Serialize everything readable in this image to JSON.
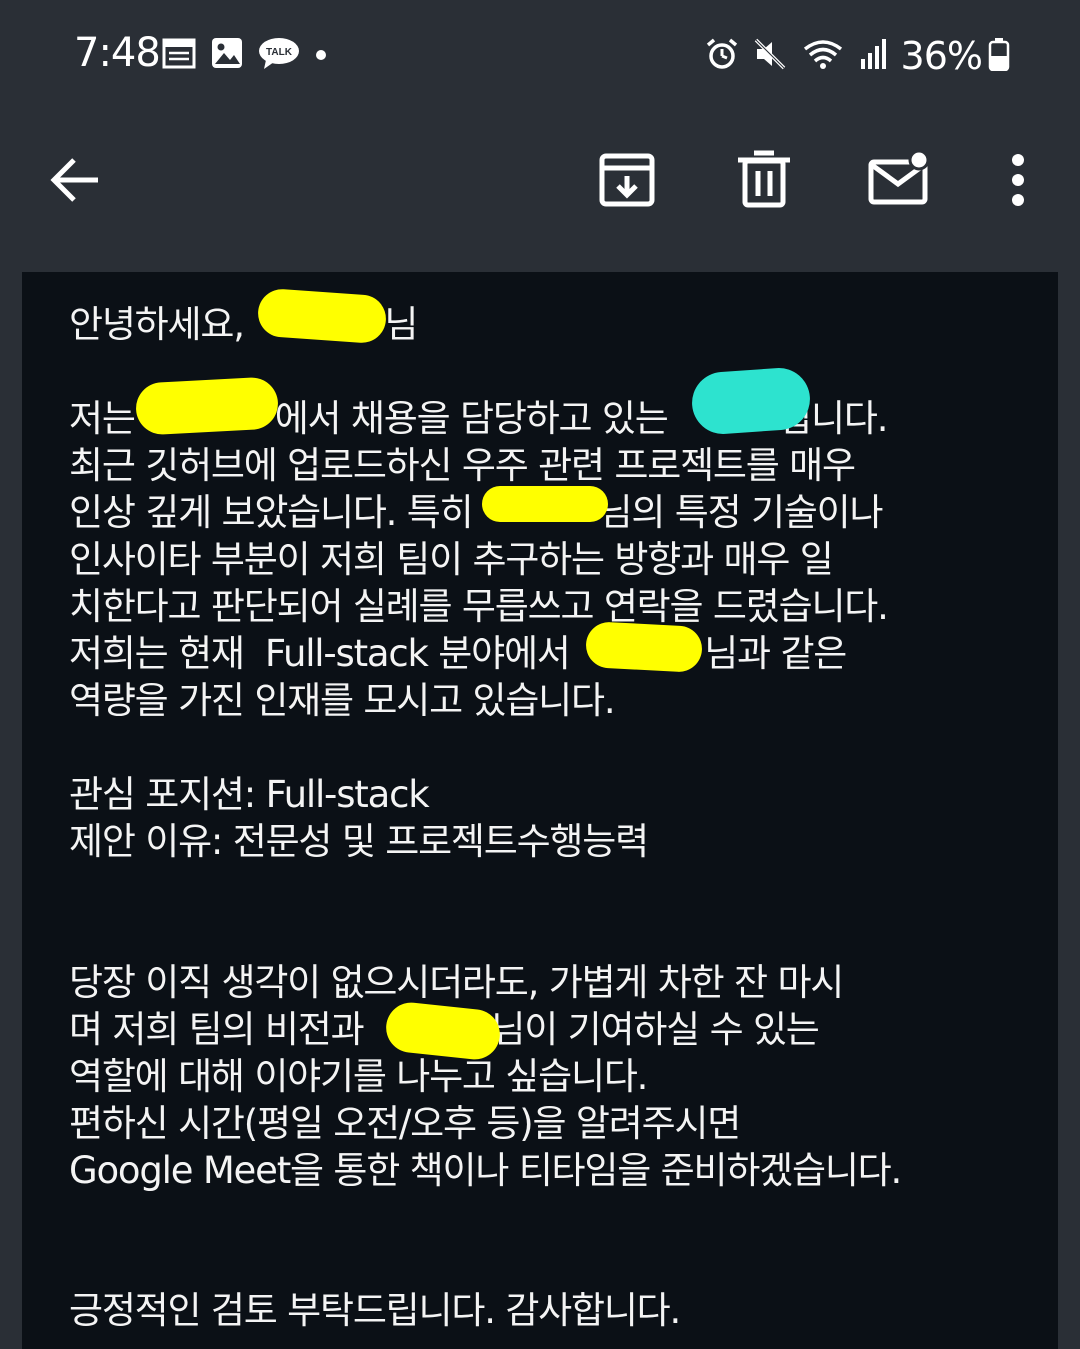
{
  "status_bar": {
    "time": "7:48",
    "left_icons": [
      "calendar-icon",
      "image-icon",
      "talk-icon",
      "notification-dot-icon"
    ],
    "talk_label": "TALK",
    "right_icons": [
      "alarm-icon",
      "mute-icon",
      "wifi-icon",
      "signal-icon",
      "battery-icon"
    ],
    "battery_percent": "36%"
  },
  "toolbar": {
    "icons": [
      "back-arrow-icon",
      "archive-icon",
      "delete-icon",
      "mark-unread-icon",
      "more-icon"
    ]
  },
  "email": {
    "lines": [
      {
        "id": "l1",
        "segs": [
          "안녕하세요, ",
          "님"
        ]
      },
      {
        "id": "l2",
        "segs": [
          "저는",
          "에서 채용을 담당하고 있는 ",
          "입니다."
        ]
      },
      {
        "id": "l3",
        "segs": [
          "최근 깃허브에 업로드하신 우주 관련 프로젝트를 매우"
        ]
      },
      {
        "id": "l4",
        "segs": [
          "인상 깊게 보았습니다. 특히",
          "님의 특정 기술이나"
        ]
      },
      {
        "id": "l5",
        "segs": [
          "인사이타 부분이 저희 팀이 추구하는 방향과 매우 일"
        ]
      },
      {
        "id": "l6",
        "segs": [
          "치한다고 판단되어 실례를 무릅쓰고 연락을 드렸습니다."
        ]
      },
      {
        "id": "l7",
        "segs": [
          "저희는 현재  Full-stack 분야에서 ",
          "님과 같은"
        ]
      },
      {
        "id": "l8",
        "segs": [
          "역량을 가진 인재를 모시고 있습니다."
        ]
      },
      {
        "id": "l9",
        "segs": [
          "관심 포지션: Full-stack"
        ]
      },
      {
        "id": "l10",
        "segs": [
          "제안 이유: 전문성 및 프로젝트수행능력"
        ]
      },
      {
        "id": "l11",
        "segs": [
          "당장 이직 생각이 없으시더라도, 가볍게 차한 잔 마시"
        ]
      },
      {
        "id": "l12",
        "segs": [
          "며 저희 팀의 비전과",
          "님이 기여하실 수 있는"
        ]
      },
      {
        "id": "l13",
        "segs": [
          "역할에 대해 이야기를 나누고 싶습니다."
        ]
      },
      {
        "id": "l14",
        "segs": [
          "편하신 시간(평일 오전/오후 등)을 알려주시면"
        ]
      },
      {
        "id": "l15",
        "segs": [
          "Google Meet을 통한 책이나 티타임을 준비하겠습니다."
        ]
      },
      {
        "id": "l16",
        "segs": [
          "긍정적인 검토 부탁드립니다. 감사합니다."
        ]
      }
    ]
  },
  "colors": {
    "app_bar": "#2a2f36",
    "body_background": "#0b1016",
    "redaction_yellow": "#ffff00",
    "redaction_cyan": "#2de3cf"
  }
}
